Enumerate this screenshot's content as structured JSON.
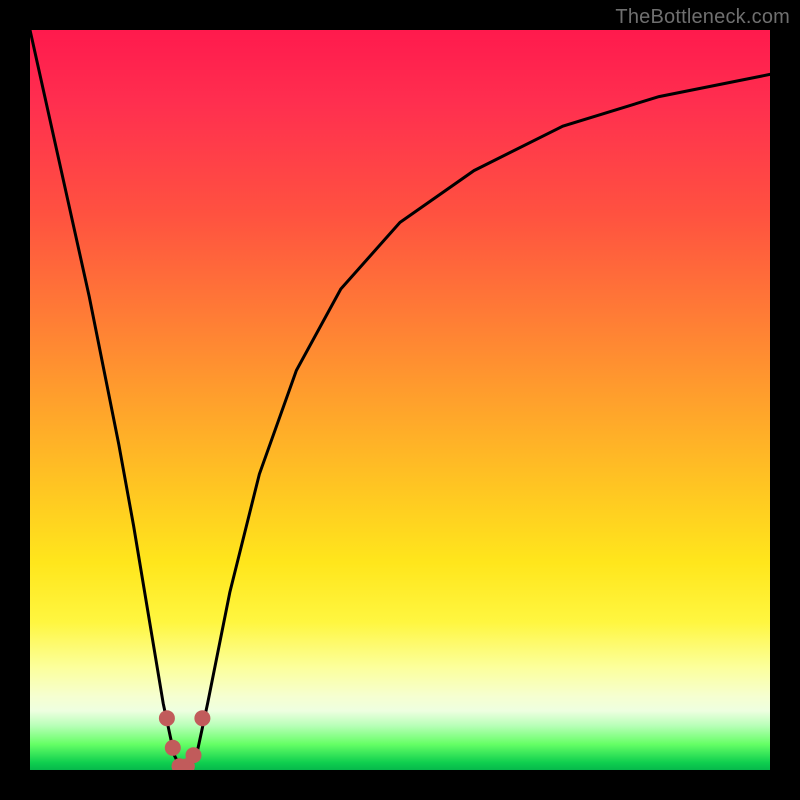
{
  "watermark": "TheBottleneck.com",
  "chart_data": {
    "type": "line",
    "title": "",
    "xlabel": "",
    "ylabel": "",
    "xlim": [
      0,
      100
    ],
    "ylim": [
      0,
      100
    ],
    "grid": false,
    "legend": false,
    "gradient_stops": [
      {
        "pos": 0,
        "color": "#ff1a4d"
      },
      {
        "pos": 10,
        "color": "#ff2f4f"
      },
      {
        "pos": 25,
        "color": "#ff5240"
      },
      {
        "pos": 38,
        "color": "#ff7a36"
      },
      {
        "pos": 50,
        "color": "#ffa02c"
      },
      {
        "pos": 62,
        "color": "#ffc622"
      },
      {
        "pos": 72,
        "color": "#ffe61c"
      },
      {
        "pos": 80,
        "color": "#fff640"
      },
      {
        "pos": 86,
        "color": "#fcff9a"
      },
      {
        "pos": 90,
        "color": "#f6ffd0"
      },
      {
        "pos": 92,
        "color": "#eeffe0"
      },
      {
        "pos": 94,
        "color": "#b8ffb8"
      },
      {
        "pos": 96.5,
        "color": "#66ff66"
      },
      {
        "pos": 99,
        "color": "#0fcf4f"
      },
      {
        "pos": 100,
        "color": "#06b84b"
      }
    ],
    "series": [
      {
        "name": "bottleneck-curve",
        "color": "#000000",
        "stroke_width": 3,
        "x": [
          0,
          2,
          4,
          6,
          8,
          10,
          12,
          14,
          16,
          18,
          19.5,
          20.5,
          21.5,
          22.5,
          24,
          27,
          31,
          36,
          42,
          50,
          60,
          72,
          85,
          100
        ],
        "y": [
          100,
          91,
          82,
          73,
          64,
          54,
          44,
          33,
          21,
          9,
          2,
          0,
          0,
          2,
          9,
          24,
          40,
          54,
          65,
          74,
          81,
          87,
          91,
          94
        ]
      },
      {
        "name": "curve-endpoints",
        "type": "scatter",
        "color": "#c15b5b",
        "marker_radius": 8,
        "points": [
          {
            "x": 18.5,
            "y": 7
          },
          {
            "x": 19.3,
            "y": 3
          },
          {
            "x": 20.2,
            "y": 0.5
          },
          {
            "x": 21.2,
            "y": 0.5
          },
          {
            "x": 22.1,
            "y": 2
          },
          {
            "x": 23.3,
            "y": 7
          }
        ]
      }
    ]
  }
}
